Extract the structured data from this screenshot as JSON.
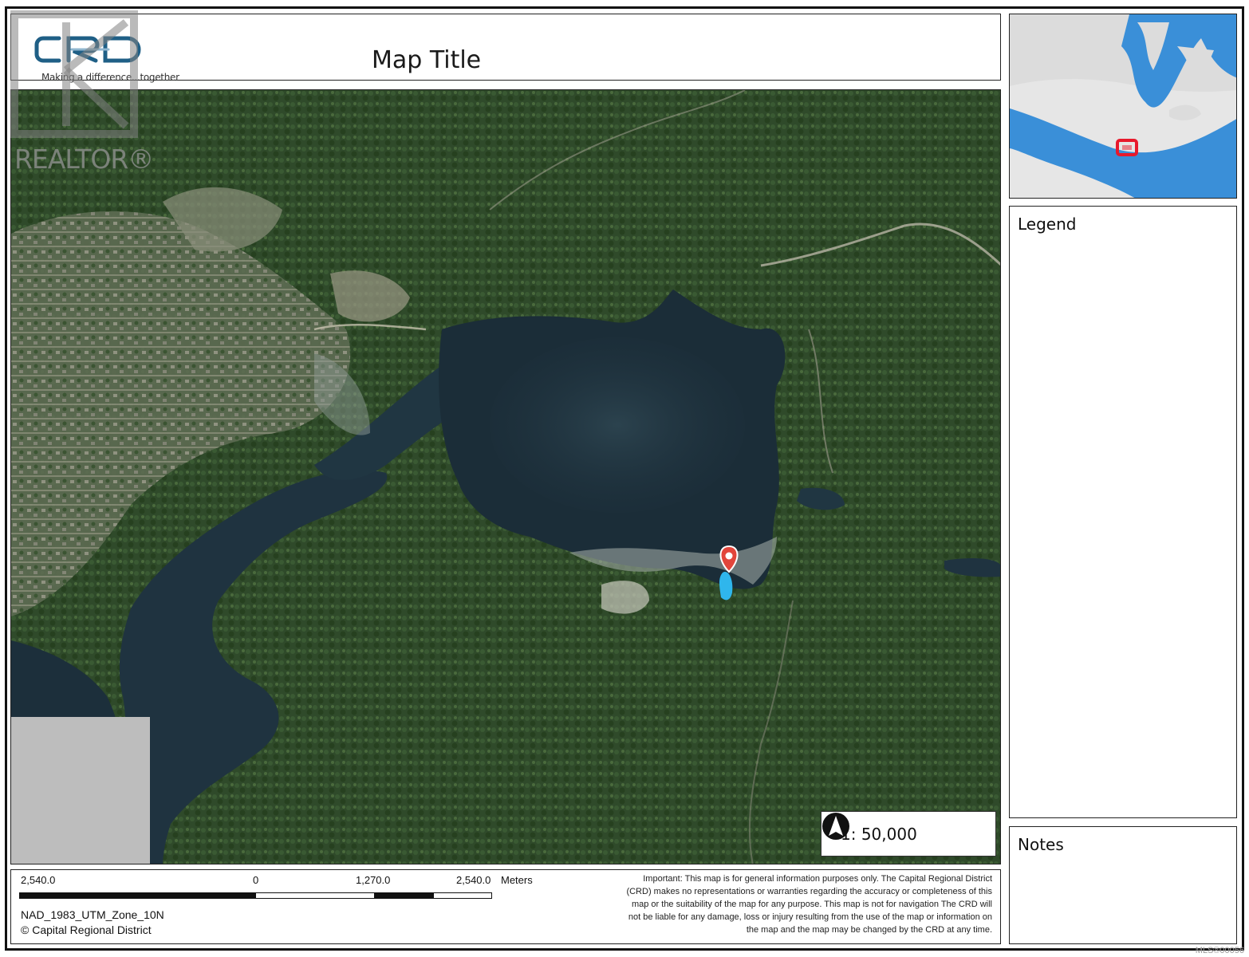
{
  "header": {
    "logo_text": "CRD",
    "logo_tagline": "Making a difference...together",
    "map_title": "Map Title"
  },
  "map": {
    "marker_icon": "map-pin-icon",
    "colors": {
      "water": "#1f3340",
      "forest": "#2f4a2a",
      "marker": "#e2453b",
      "parcel": "#2fb6ec"
    }
  },
  "scale_indicator": {
    "ratio_text": "1: 50,000",
    "north_icon": "north-arrow-icon"
  },
  "inset": {
    "colors": {
      "water": "#3a8fd8",
      "land": "#dcdcdc",
      "highlight": "#e8192c"
    }
  },
  "legend": {
    "title": "Legend"
  },
  "notes": {
    "title": "Notes"
  },
  "scalebar": {
    "labels": [
      "2,540.0",
      "0",
      "1,270.0",
      "2,540.0"
    ],
    "units": "Meters"
  },
  "footer": {
    "projection": "NAD_1983_UTM_Zone_10N",
    "copyright": "© Capital Regional District",
    "disclaimer_lines": [
      "Important: This map is for general information purposes only. The Capital Regional District",
      "(CRD) makes no representations or warranties regarding the accuracy or completeness of this",
      "map or the suitability of the map for any purpose. This map is not for navigation  The CRD will",
      "not be liable for any damage, loss or injury resulting from the use of the map or information on",
      "the map and the map may be changed by the CRD at any time."
    ]
  },
  "watermark": {
    "text": "REALTOR®"
  },
  "mls_number": "MLS®00056"
}
